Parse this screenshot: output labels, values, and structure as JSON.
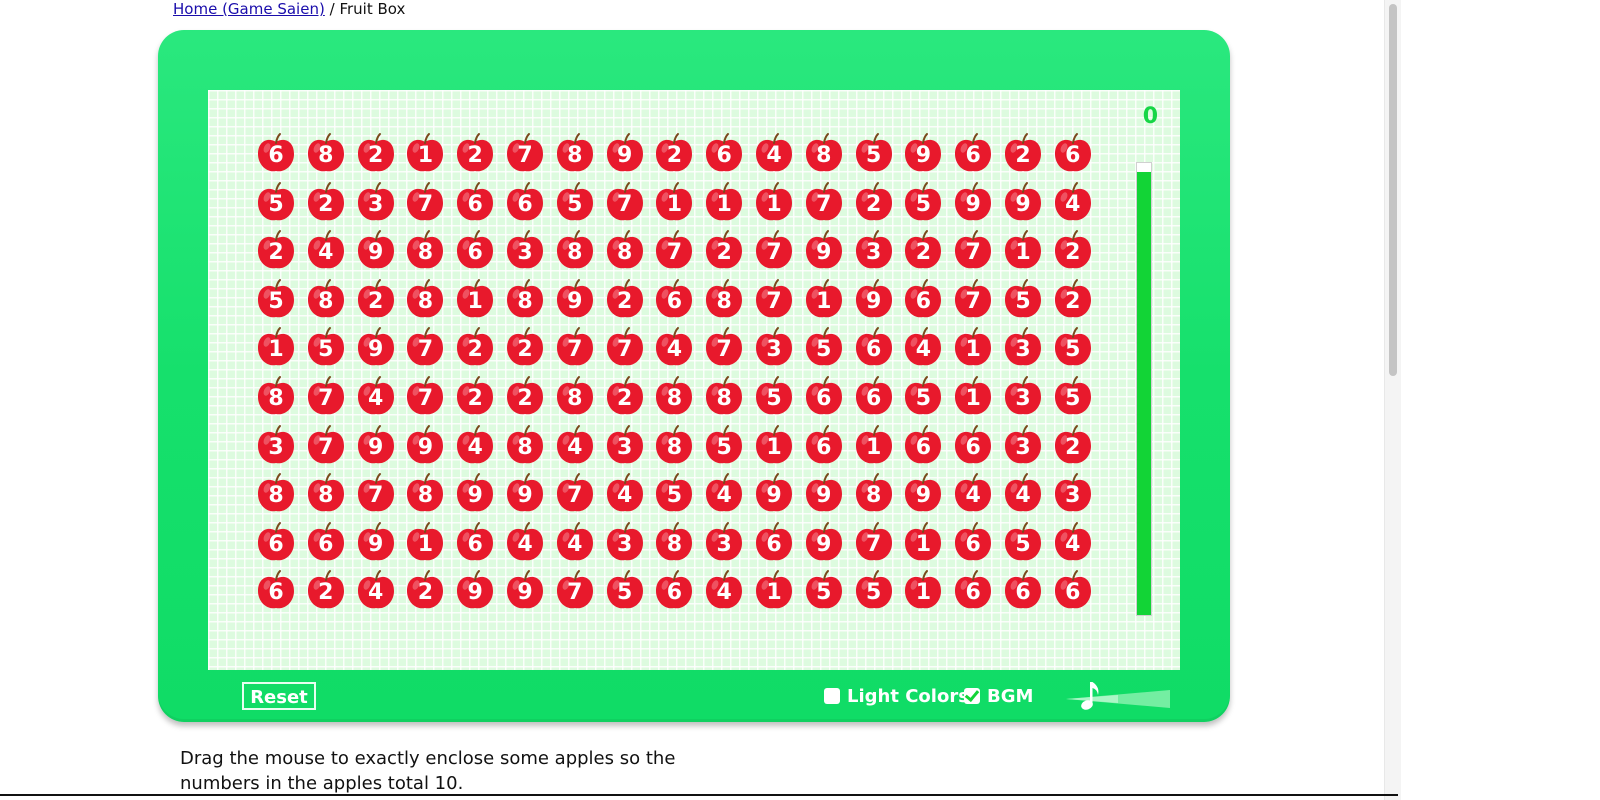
{
  "breadcrumb": {
    "home_link": "Home (Game Saien)",
    "separator": "/",
    "current": "Fruit Box"
  },
  "game": {
    "score": "0",
    "timer_remaining": 0.98,
    "grid": [
      [
        6,
        8,
        2,
        1,
        2,
        7,
        8,
        9,
        2,
        6,
        4,
        8,
        5,
        9,
        6,
        2,
        6
      ],
      [
        5,
        2,
        3,
        7,
        6,
        6,
        5,
        7,
        1,
        1,
        1,
        7,
        2,
        5,
        9,
        9,
        4
      ],
      [
        2,
        4,
        9,
        8,
        6,
        3,
        8,
        8,
        7,
        2,
        7,
        9,
        3,
        2,
        7,
        1,
        2
      ],
      [
        5,
        8,
        2,
        8,
        1,
        8,
        9,
        2,
        6,
        8,
        7,
        1,
        9,
        6,
        7,
        5,
        2
      ],
      [
        1,
        5,
        9,
        7,
        2,
        2,
        7,
        7,
        4,
        7,
        3,
        5,
        6,
        4,
        1,
        3,
        5
      ],
      [
        8,
        7,
        4,
        7,
        2,
        2,
        8,
        2,
        8,
        8,
        5,
        6,
        6,
        5,
        1,
        3,
        5
      ],
      [
        3,
        7,
        9,
        9,
        4,
        8,
        4,
        3,
        8,
        5,
        1,
        6,
        1,
        6,
        6,
        3,
        2
      ],
      [
        8,
        8,
        7,
        8,
        9,
        9,
        7,
        4,
        5,
        4,
        9,
        9,
        8,
        9,
        4,
        4,
        3
      ],
      [
        6,
        6,
        9,
        1,
        6,
        4,
        4,
        3,
        8,
        3,
        6,
        9,
        7,
        1,
        6,
        5,
        4
      ],
      [
        6,
        2,
        4,
        2,
        9,
        9,
        7,
        5,
        6,
        4,
        1,
        5,
        5,
        1,
        6,
        6,
        6
      ]
    ],
    "apple_color": "#e8192c",
    "frame_color": "#16e06c",
    "timer_color": "#12d436"
  },
  "controls": {
    "reset_label": "Reset",
    "light_colors_label": "Light Colors",
    "light_colors_checked": false,
    "bgm_label": "BGM",
    "bgm_checked": true,
    "volume_icon": "music-note-icon"
  },
  "instructions": {
    "line1": "Drag the mouse to exactly enclose some apples so the",
    "line2": "numbers in the apples total 10."
  }
}
